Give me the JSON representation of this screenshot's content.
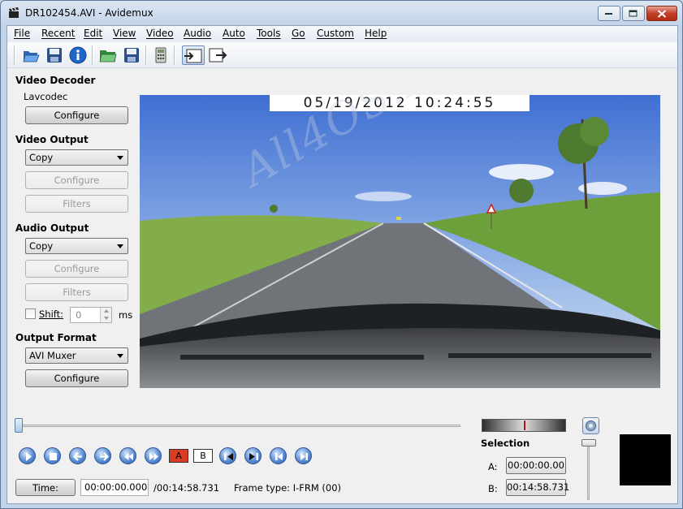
{
  "window": {
    "title": "DR102454.AVI - Avidemux"
  },
  "menu": {
    "items": [
      "File",
      "Recent",
      "Edit",
      "View",
      "Video",
      "Audio",
      "Auto",
      "Tools",
      "Go",
      "Custom",
      "Help"
    ]
  },
  "toolbar": {
    "buttons": [
      "open-icon",
      "save-icon",
      "info-icon",
      "open-folder-icon",
      "save-video-icon",
      "calculator-icon",
      "input-mode-icon",
      "output-mode-icon"
    ]
  },
  "left_panel": {
    "video_decoder": {
      "heading": "Video Decoder",
      "codec": "Lavcodec",
      "configure": "Configure"
    },
    "video_output": {
      "heading": "Video Output",
      "selected": "Copy",
      "configure": "Configure",
      "filters": "Filters"
    },
    "audio_output": {
      "heading": "Audio Output",
      "selected": "Copy",
      "configure": "Configure",
      "filters": "Filters",
      "shift_label": "Shift:",
      "shift_value": "0",
      "shift_unit": "ms"
    },
    "output_format": {
      "heading": "Output Format",
      "selected": "AVI Muxer",
      "configure": "Configure"
    }
  },
  "video": {
    "timestamp": "05/19/2012  10:24:55",
    "watermark": "All4OS.RU"
  },
  "navigation": {
    "a_marker": "A",
    "b_marker": "B",
    "time_button": "Time:",
    "current_time": "00:00:00.000",
    "total_time": "/00:14:58.731",
    "frame_type": "Frame type:  I-FRM (00)"
  },
  "selection": {
    "heading": "Selection",
    "a_label": "A:",
    "a_value": "00:00:00.00",
    "b_label": "B:",
    "b_value": "00:14:58.731"
  },
  "colors": {
    "window_frame": "#c4d4e8",
    "panel_bg": "#f0f0f0",
    "sky": "#5f8ad8",
    "road": "#6f7378",
    "grass": "#6fa03c",
    "accent_blue": "#2c5ca8"
  }
}
